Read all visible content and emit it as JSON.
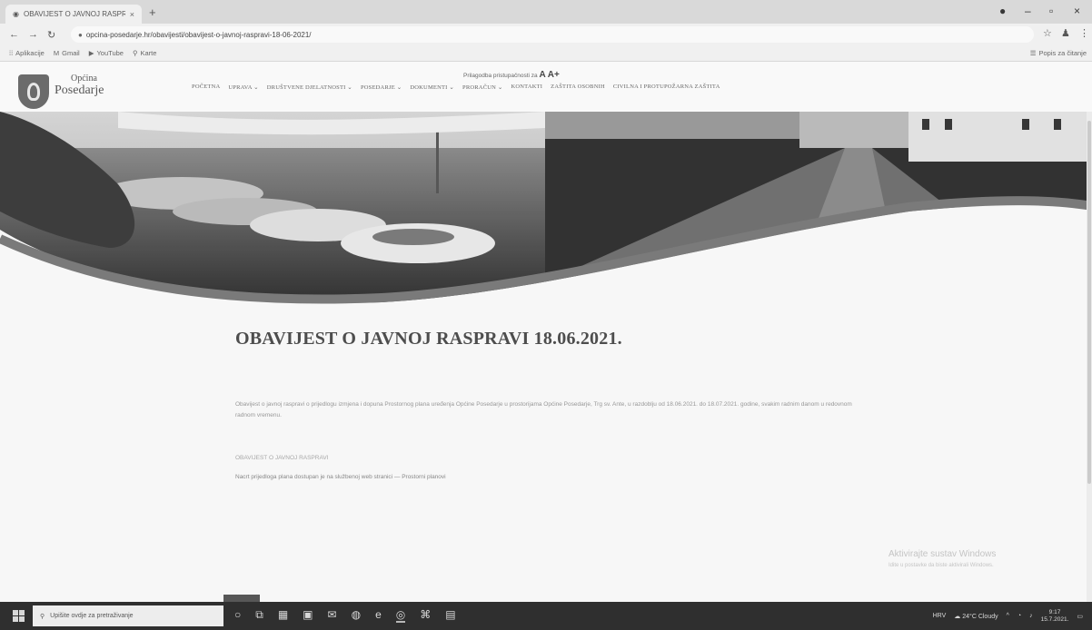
{
  "browser": {
    "tab_title": "OBAVIJEST O JAVNOJ RASPRAVI",
    "url": "opcina-posedarje.hr/obavijesti/obavijest-o-javnoj-raspravi-18-06-2021/",
    "bookmarks": [
      "Aplikacije",
      "Gmail",
      "YouTube",
      "Karte"
    ],
    "reading_list": "Popis za čitanje"
  },
  "site": {
    "logo_line1": "Općina",
    "logo_line2": "Posedarje",
    "accessibility_text": "Prilagodba pristupačnosti za",
    "accessibility_sizes": "A A+",
    "nav": [
      "POČETNA",
      "UPRAVA",
      "DRUŠTVENE DJELATNOSTI",
      "POSEDARJE",
      "DOKUMENTI",
      "PRORAČUN",
      "KONTAKTI",
      "ZAŠTITA OSOBNIH",
      "CIVILNA I PROTUPOŽARNA ZAŠTITA"
    ]
  },
  "article": {
    "title": "OBAVIJEST O JAVNOJ RASPRAVI 18.06.2021.",
    "body": "Obavijest o javnoj raspravi o prijedlogu izmjena i dopuna Prostornog plana uređenja Općine Posedarje u prostorijama Općine Posedarje, Trg sv. Ante, u razdoblju od 18.06.2021. do 18.07.2021. godine, svakim radnim danom u redovnom radnom vremenu.",
    "doc_link": "OBAVIJEST O JAVNOJ RASPRAVI",
    "doc_note": "Nacrt prijedloga plana dostupan je na službenoj web stranici — Prostorni planovi"
  },
  "windows": {
    "activate_title": "Aktivirajte sustav Windows",
    "activate_sub": "Idite u postavke da biste aktivirali Windows."
  },
  "taskbar": {
    "search_placeholder": "Upišite ovdje za pretraživanje",
    "weather": "24°C Cloudy",
    "lang": "HRV",
    "time": "9:17",
    "date": "15.7.2021."
  }
}
